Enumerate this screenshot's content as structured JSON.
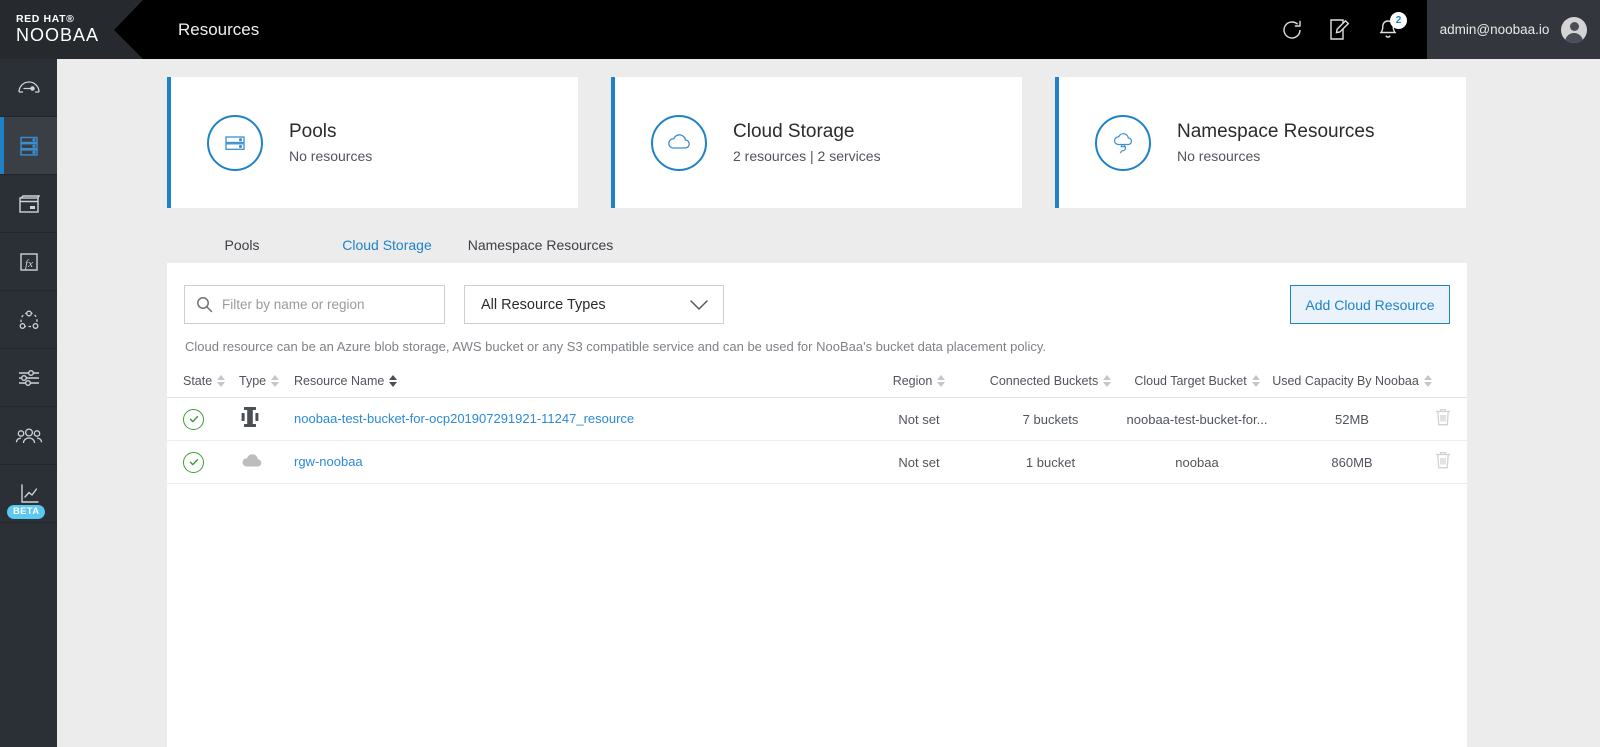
{
  "topbar": {
    "brand_line1": "RED HAT®",
    "brand_line2": "NOOBAA",
    "page_title": "Resources",
    "refresh_icon": "refresh-icon",
    "edit_icon": "edit-note-icon",
    "bell_icon": "notifications-bell-icon",
    "notification_count": "2",
    "account_name": "admin@noobaa.io",
    "avatar_icon": "user-avatar-icon"
  },
  "sidebar": {
    "items": [
      {
        "name": "sidebar-item-overview",
        "icon": "gauge-icon",
        "active": false
      },
      {
        "name": "sidebar-item-resources",
        "icon": "server-stack-icon",
        "active": true
      },
      {
        "name": "sidebar-item-buckets",
        "icon": "bucket-icon",
        "active": false
      },
      {
        "name": "sidebar-item-functions",
        "icon": "fx-function-icon",
        "active": false
      },
      {
        "name": "sidebar-item-namespace",
        "icon": "topology-nodes-icon",
        "active": false
      },
      {
        "name": "sidebar-item-settings",
        "icon": "sliders-icon",
        "active": false
      },
      {
        "name": "sidebar-item-accounts",
        "icon": "users-group-icon",
        "active": false
      },
      {
        "name": "sidebar-item-analytics",
        "icon": "line-chart-icon",
        "active": false,
        "badge": "BETA"
      }
    ]
  },
  "cards": [
    {
      "title": "Pools",
      "subtitle": "No resources",
      "icon": "server-stack-icon"
    },
    {
      "title": "Cloud Storage",
      "subtitle": "2 resources | 2 services",
      "icon": "cloud-icon"
    },
    {
      "title": "Namespace Resources",
      "subtitle": "No resources",
      "icon": "cloud-plug-icon"
    }
  ],
  "tabs": [
    {
      "label": "Pools",
      "active": false
    },
    {
      "label": "Cloud Storage",
      "active": true
    },
    {
      "label": "Namespace Resources",
      "active": false
    }
  ],
  "toolbar": {
    "search_value": "",
    "search_placeholder": "Filter by name or region",
    "search_icon": "search-icon",
    "type_filter_value": "All Resource Types",
    "type_filter_chevron": "chevron-down-icon",
    "add_button_label": "Add Cloud Resource",
    "description": "Cloud resource can be an Azure blob storage, AWS bucket or any S3 compatible service and can be used for NooBaa's bucket data placement policy."
  },
  "table": {
    "columns": [
      {
        "label": "State",
        "sorted": false
      },
      {
        "label": "Type",
        "sorted": false
      },
      {
        "label": "Resource Name",
        "sorted": true
      },
      {
        "label": "Region",
        "sorted": false
      },
      {
        "label": "Connected Buckets",
        "sorted": false
      },
      {
        "label": "Cloud Target Bucket",
        "sorted": false
      },
      {
        "label": "Used Capacity By Noobaa",
        "sorted": false
      }
    ],
    "rows": [
      {
        "state_icon": "status-healthy-check-icon",
        "type_icon": "s3-compatible-icon",
        "name": "noobaa-test-bucket-for-ocp201907291921-11247_resource",
        "region": "Not set",
        "connected_buckets": "7 buckets",
        "cloud_target_bucket": "noobaa-test-bucket-for...",
        "used_capacity": "52MB",
        "delete_icon": "trash-icon"
      },
      {
        "state_icon": "status-healthy-check-icon",
        "type_icon": "cloud-filled-icon",
        "name": "rgw-noobaa",
        "region": "Not set",
        "connected_buckets": "1 bucket",
        "cloud_target_bucket": "noobaa",
        "used_capacity": "860MB",
        "delete_icon": "trash-icon"
      }
    ]
  },
  "colors": {
    "accent_blue": "#1f82c9",
    "link_blue": "#2d8ad6",
    "status_green": "#3f9c35",
    "topbar_black": "#000000",
    "sidebar_dark": "#2b2f36",
    "page_bg": "#ececec",
    "beta_badge": "#5bc8ef"
  }
}
